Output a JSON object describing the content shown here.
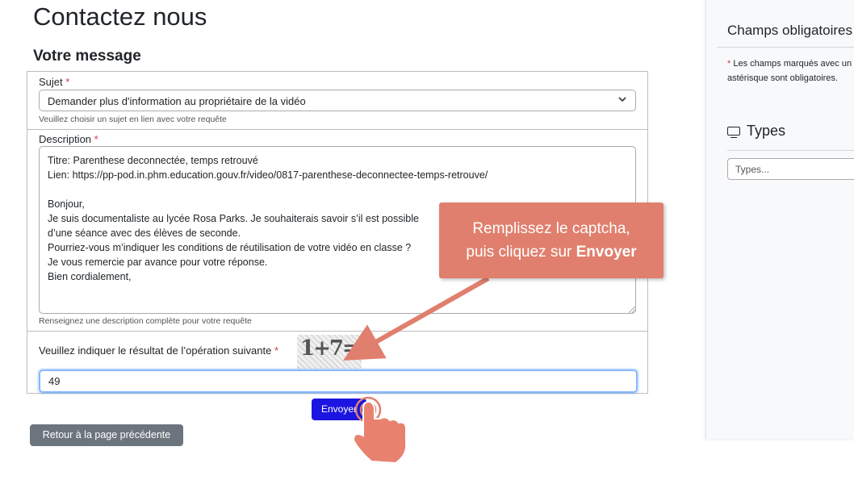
{
  "page": {
    "title": "Contactez nous",
    "section_title": "Votre message"
  },
  "form": {
    "subject_label": "Sujet",
    "subject_required": "*",
    "subject_value": "Demander plus d'information au propriétaire de la vidéo",
    "subject_hint": "Veuillez choisir un sujet en lien avec votre requête",
    "description_label": "Description",
    "description_required": "*",
    "description_value": "Titre: Parenthese deconnectée, temps retrouvé\nLien: https://pp-pod.in.phm.education.gouv.fr/video/0817-parenthese-deconnectee-temps-retrouve/\n\nBonjour,\nJe suis documentaliste au lycée Rosa Parks. Je souhaiterais savoir s’il est possible\nd’une séance avec des élèves de seconde.\nPourriez-vous m’indiquer les conditions de réutilisation de votre vidéo en classe ?\nJe vous remercie par avance pour votre réponse.\nBien cordialement,",
    "description_hint": "Renseignez une description complète pour votre requête",
    "captcha_label": "Veuillez indiquer le résultat de l’opération suivante",
    "captcha_required": "*",
    "captcha_image_text": "1+7=",
    "captcha_value": "49"
  },
  "buttons": {
    "send": "Envoyer",
    "back": "Retour à la page précédente"
  },
  "sidebar": {
    "required_title": "Champs obligatoires",
    "required_star": "*",
    "required_note": "Les champs marqués avec un astérisque sont obligatoires.",
    "types_title": "Types",
    "types_placeholder": "Types..."
  },
  "tutorial": {
    "callout_line1": "Remplissez le captcha,",
    "callout_line2_prefix": "puis cliquez sur",
    "callout_line2_bold": "Envoyer",
    "accent_color": "#e07f6d"
  },
  "colors": {
    "primary_button": "#1c14e0",
    "secondary_button": "#6c757d",
    "required": "#dc3545"
  }
}
